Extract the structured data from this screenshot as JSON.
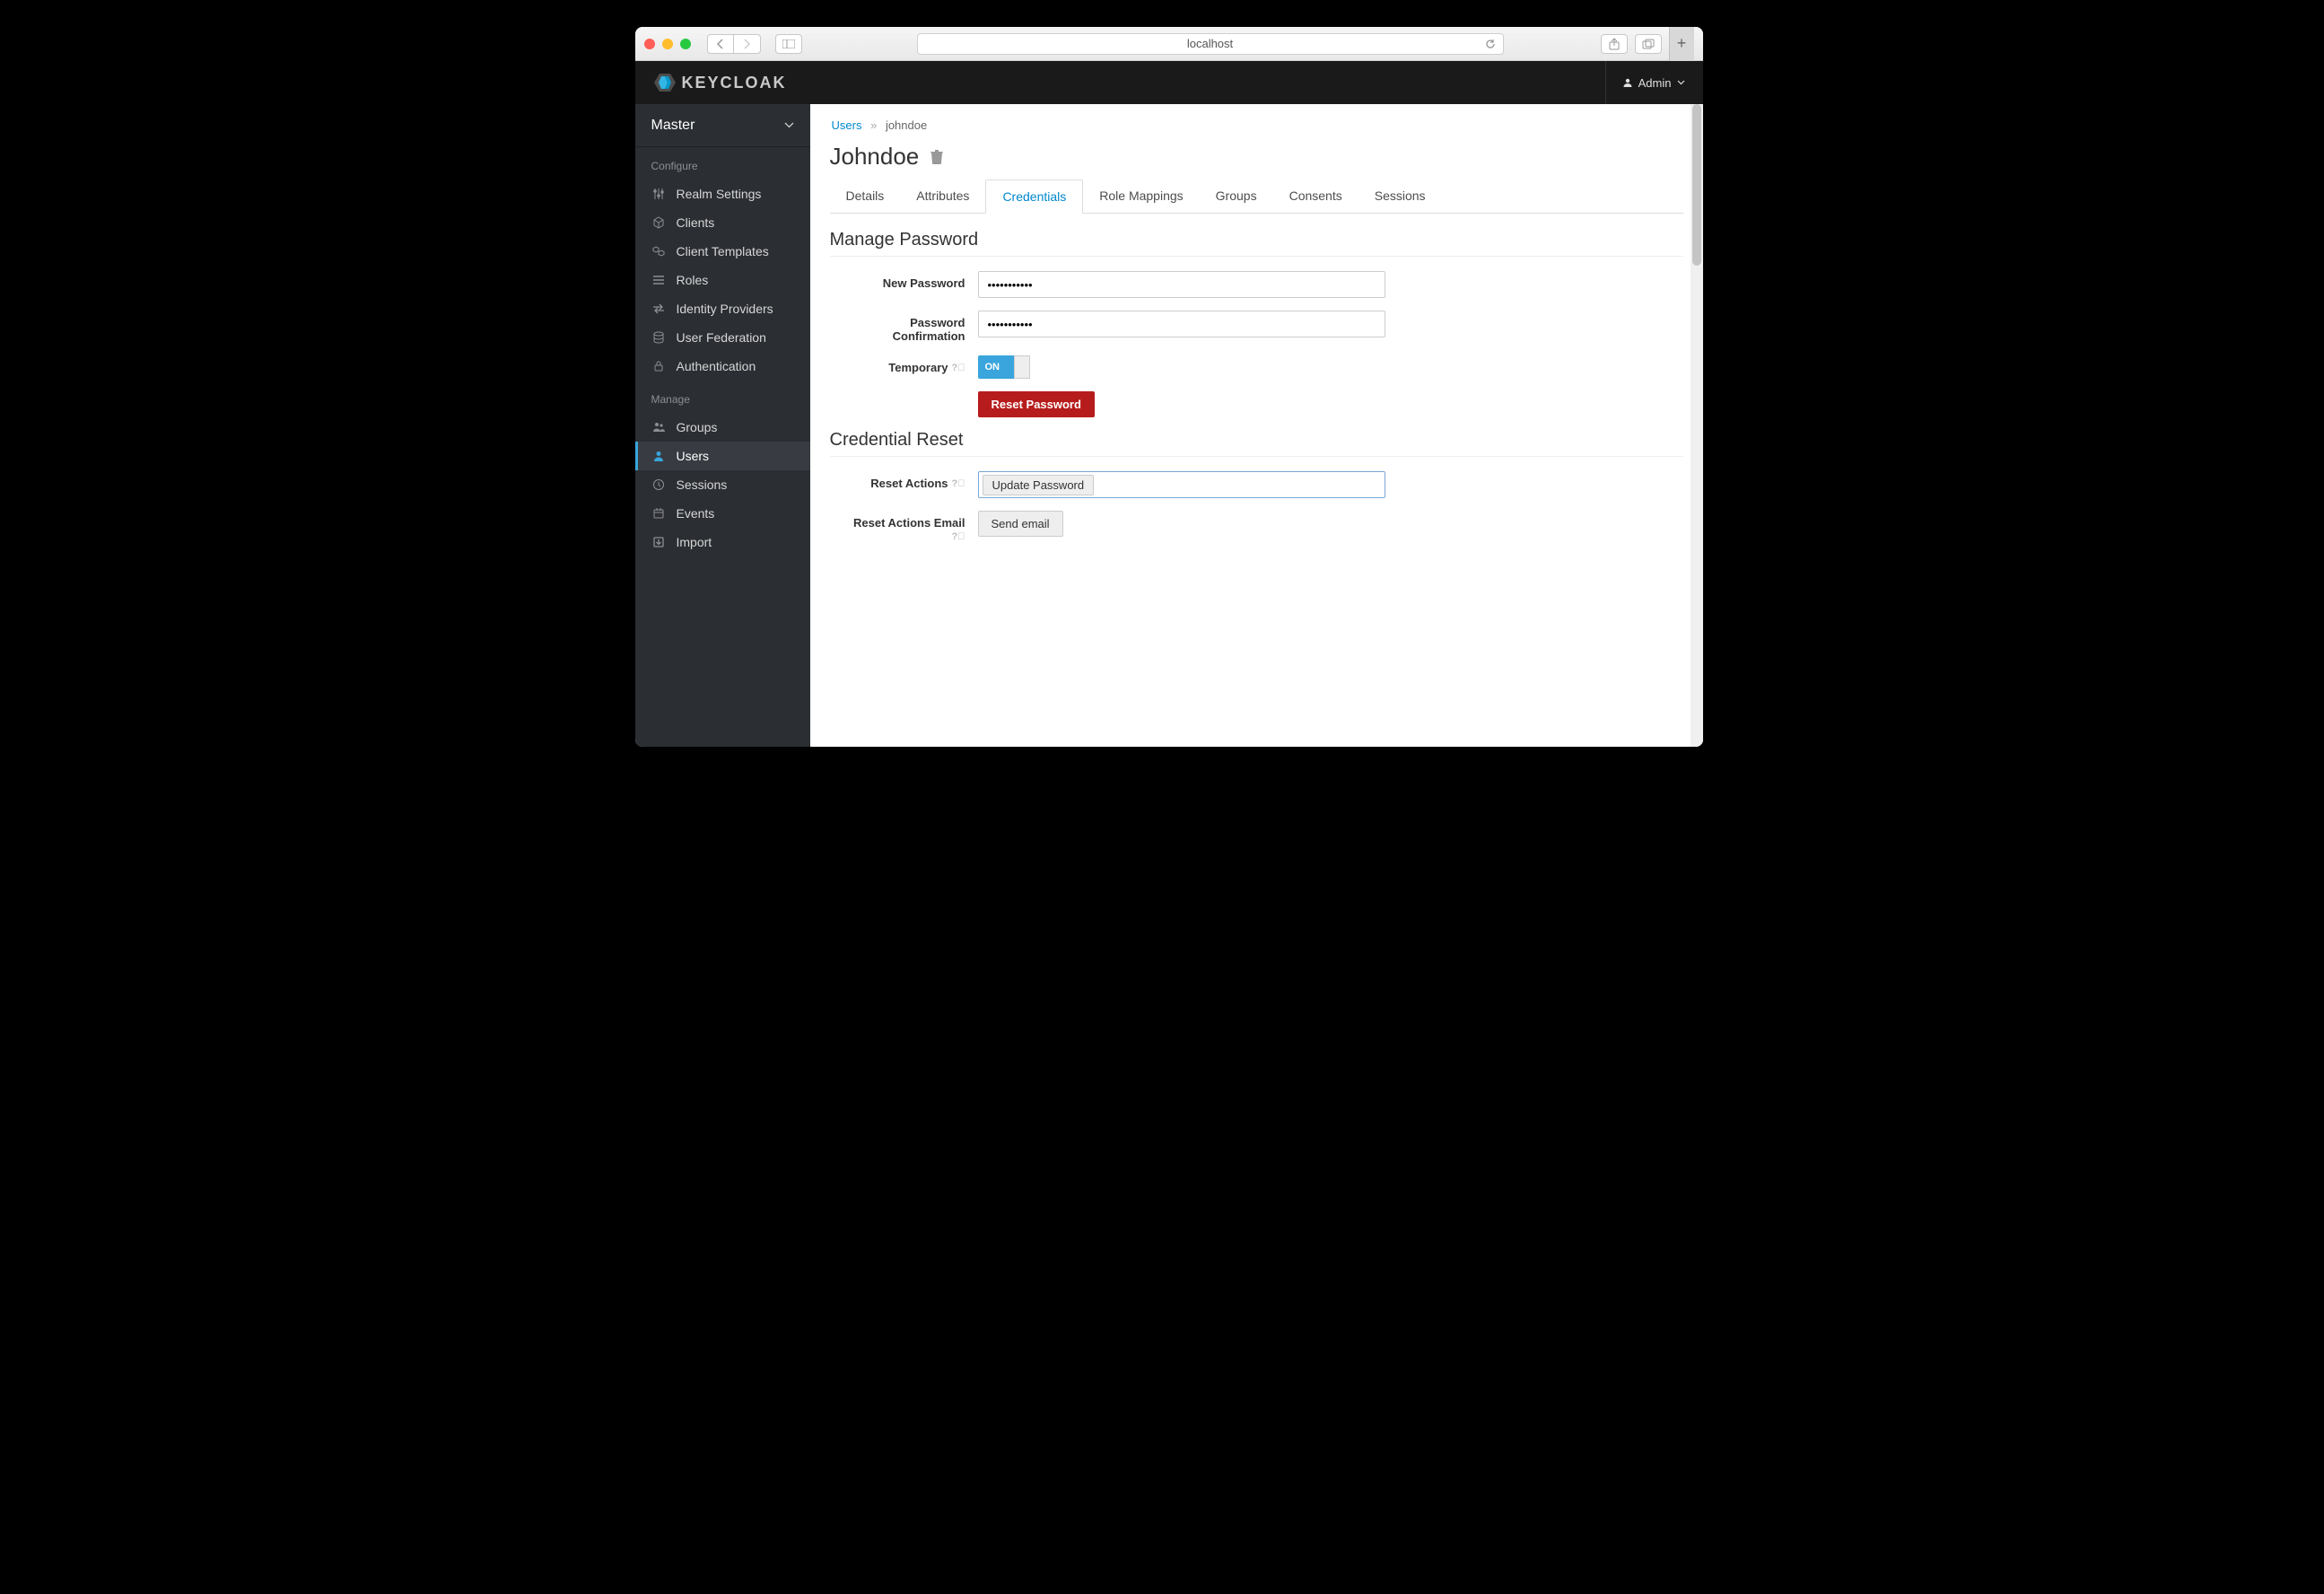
{
  "browser": {
    "url": "localhost"
  },
  "header": {
    "brand": "KEYCLOAK",
    "user": "Admin"
  },
  "sidebar": {
    "realm": "Master",
    "configure_label": "Configure",
    "manage_label": "Manage",
    "configure": [
      {
        "label": "Realm Settings"
      },
      {
        "label": "Clients"
      },
      {
        "label": "Client Templates"
      },
      {
        "label": "Roles"
      },
      {
        "label": "Identity Providers"
      },
      {
        "label": "User Federation"
      },
      {
        "label": "Authentication"
      }
    ],
    "manage": [
      {
        "label": "Groups"
      },
      {
        "label": "Users"
      },
      {
        "label": "Sessions"
      },
      {
        "label": "Events"
      },
      {
        "label": "Import"
      }
    ]
  },
  "breadcrumb": {
    "parent": "Users",
    "current": "johndoe"
  },
  "page": {
    "title": "Johndoe"
  },
  "tabs": [
    {
      "label": "Details"
    },
    {
      "label": "Attributes"
    },
    {
      "label": "Credentials"
    },
    {
      "label": "Role Mappings"
    },
    {
      "label": "Groups"
    },
    {
      "label": "Consents"
    },
    {
      "label": "Sessions"
    }
  ],
  "sections": {
    "manage_password": "Manage Password",
    "credential_reset": "Credential Reset"
  },
  "form": {
    "new_password_label": "New Password",
    "new_password_value": "•••••••••••",
    "confirm_label_line1": "Password",
    "confirm_label_line2": "Confirmation",
    "confirm_value": "•••••••••••",
    "temporary_label": "Temporary",
    "temporary_value": "ON",
    "reset_password_btn": "Reset Password",
    "reset_actions_label": "Reset Actions",
    "reset_actions_chip": "Update Password",
    "reset_email_label": "Reset Actions Email",
    "send_email_btn": "Send email"
  }
}
